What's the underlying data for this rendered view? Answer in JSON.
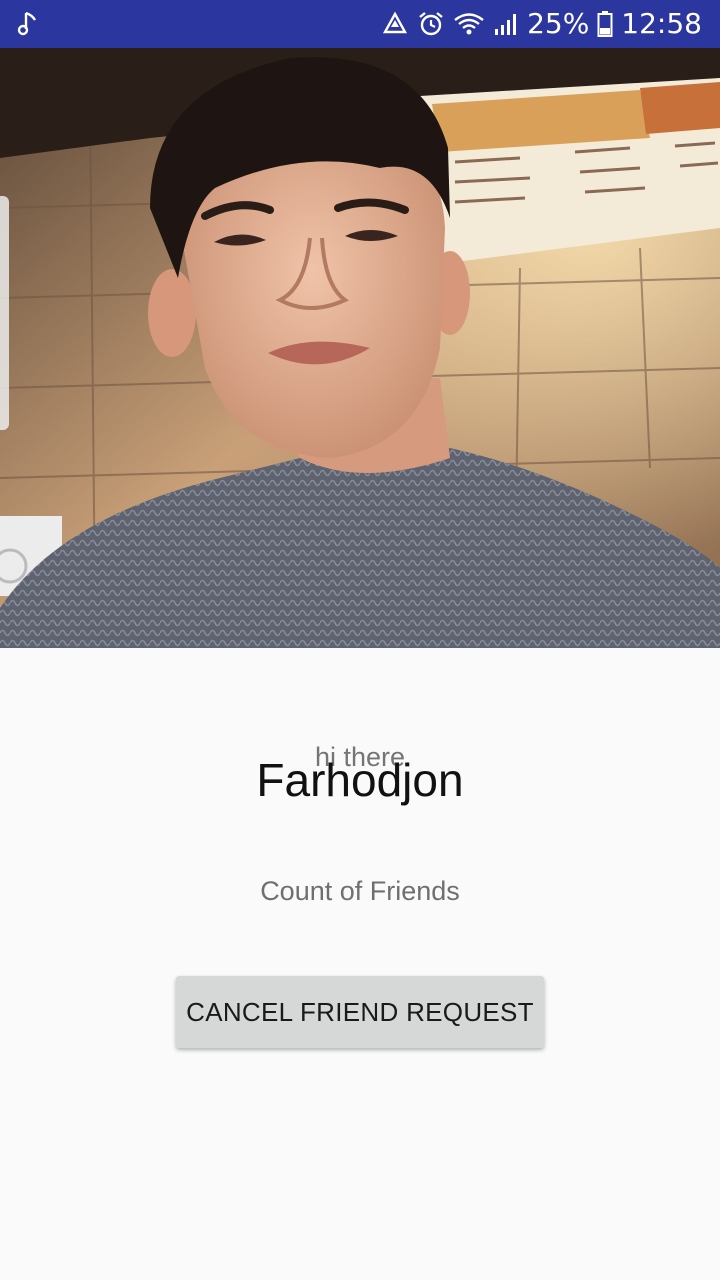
{
  "status_bar": {
    "battery_percent": "25%",
    "time": "12:58",
    "icons": [
      "music-note-icon",
      "recycle-icon",
      "alarm-icon",
      "wifi-icon",
      "signal-icon",
      "battery-icon"
    ]
  },
  "profile": {
    "display_name": "Farhodjon",
    "status": "hi there",
    "friends_count_label": "Count of Friends"
  },
  "actions": {
    "friend_request_label": "CANCEL FRIEND REQUEST"
  },
  "colors": {
    "status_bar": "#2b369e",
    "background": "#fafafa",
    "button": "#d6d7d7"
  }
}
